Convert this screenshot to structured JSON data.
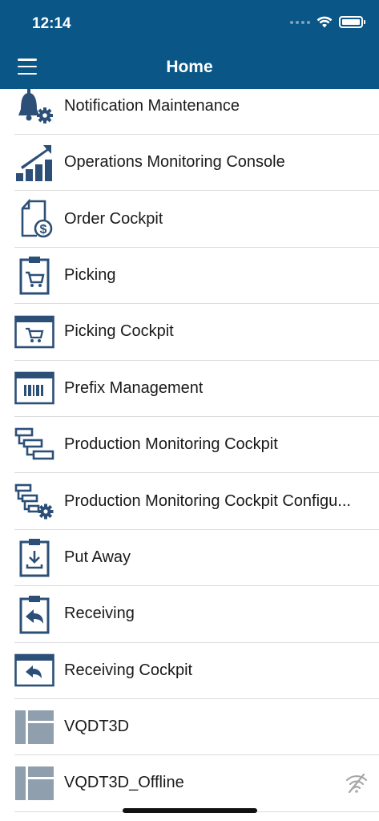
{
  "status_bar": {
    "time": "12:14"
  },
  "nav": {
    "title": "Home"
  },
  "items": [
    {
      "label": "Notification Maintenance",
      "icon": "bell-gear-icon"
    },
    {
      "label": "Operations Monitoring Console",
      "icon": "growth-chart-icon"
    },
    {
      "label": "Order Cockpit",
      "icon": "document-dollar-icon"
    },
    {
      "label": "Picking",
      "icon": "clipboard-cart-icon"
    },
    {
      "label": "Picking Cockpit",
      "icon": "window-cart-icon"
    },
    {
      "label": "Prefix Management",
      "icon": "window-barcode-icon"
    },
    {
      "label": "Production Monitoring Cockpit",
      "icon": "hierarchy-icon"
    },
    {
      "label": "Production Monitoring Cockpit Configu...",
      "icon": "hierarchy-gear-icon"
    },
    {
      "label": "Put Away",
      "icon": "clipboard-download-icon"
    },
    {
      "label": "Receiving",
      "icon": "clipboard-return-icon"
    },
    {
      "label": "Receiving Cockpit",
      "icon": "window-return-icon"
    },
    {
      "label": "VQDT3D",
      "icon": "layout-icon"
    },
    {
      "label": "VQDT3D_Offline",
      "icon": "layout-icon",
      "badge_icon": "offline-wifi-icon"
    }
  ],
  "colors": {
    "header": "#0a5687",
    "icon_primary": "#2c4f78",
    "icon_muted": "#8f9fad"
  }
}
